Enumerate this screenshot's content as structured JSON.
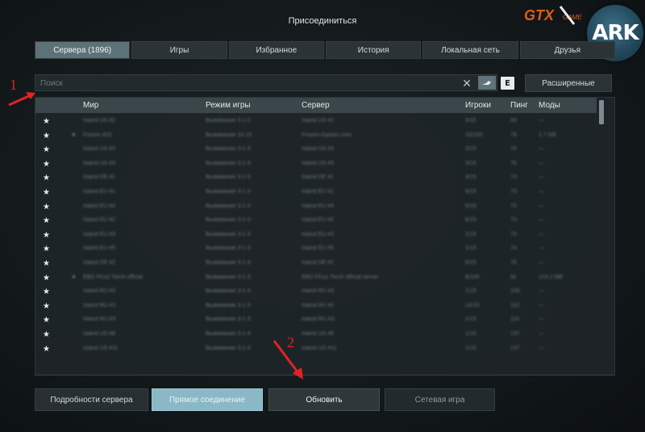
{
  "window": {
    "title": "Присоединиться"
  },
  "logos": {
    "gtx": "GTX",
    "gtx_small": "GAME",
    "ark": "ARK"
  },
  "tabs": [
    {
      "label": "Сервера (1896)",
      "active": true
    },
    {
      "label": "Игры",
      "active": false
    },
    {
      "label": "Избранное",
      "active": false
    },
    {
      "label": "История",
      "active": false
    },
    {
      "label": "Локальная сеть",
      "active": false
    },
    {
      "label": "Друзья",
      "active": false
    }
  ],
  "search": {
    "placeholder": "Поиск",
    "value": "",
    "clear_icon": "close-icon",
    "steam_icon": "steam-icon",
    "epic_icon": "E"
  },
  "advanced_button": "Расширенные",
  "columns": {
    "world": "Мир",
    "game_mode": "Режим игры",
    "server": "Сервер",
    "players": "Игроки",
    "ping": "Пинг",
    "mods": "Моды"
  },
  "rows": [
    {
      "world": "Island US #2",
      "mode": "Выживание 3-1-3",
      "server": "Island US #2",
      "players": "3/15",
      "ping": "69",
      "mods": "—",
      "flag": false
    },
    {
      "world": "Frozen #23",
      "mode": "Выживание 10-10",
      "server": "Frozen-Games.com",
      "players": "10/100",
      "ping": "79",
      "mods": "1.7 GB",
      "flag": true
    },
    {
      "world": "Island US #3",
      "mode": "Выживание 3-1-3",
      "server": "Island US #3",
      "players": "3/15",
      "ping": "70",
      "mods": "—",
      "flag": false
    },
    {
      "world": "Island US #3",
      "mode": "Выживание 3-1-3",
      "server": "Island US #3",
      "players": "3/15",
      "ping": "70",
      "mods": "—",
      "flag": false
    },
    {
      "world": "Island DE #1",
      "mode": "Выживание 3-1-3",
      "server": "Island DE #1",
      "players": "3/15",
      "ping": "73",
      "mods": "—",
      "flag": false
    },
    {
      "world": "Island EU #1",
      "mode": "Выживание 3-1-3",
      "server": "Island EU #1",
      "players": "6/15",
      "ping": "73",
      "mods": "—",
      "flag": false
    },
    {
      "world": "Island EU #4",
      "mode": "Выживание 3-1-3",
      "server": "Island EU #4",
      "players": "6/15",
      "ping": "73",
      "mods": "—",
      "flag": false
    },
    {
      "world": "Island EU #2",
      "mode": "Выживание 3-1-3",
      "server": "Island EU #2",
      "players": "6/15",
      "ping": "73",
      "mods": "—",
      "flag": false
    },
    {
      "world": "Island EU #3",
      "mode": "Выживание 3-1-3",
      "server": "Island EU #3",
      "players": "1/15",
      "ping": "73",
      "mods": "—",
      "flag": false
    },
    {
      "world": "Island EU #5",
      "mode": "Выживание 3-1-3",
      "server": "Island EU #5",
      "players": "1/15",
      "ping": "74",
      "mods": "—",
      "flag": false
    },
    {
      "world": "Island DE #2",
      "mode": "Выживание 3-1-3",
      "server": "Island DE #2",
      "players": "6/15",
      "ping": "75",
      "mods": "—",
      "flag": false
    },
    {
      "world": "EBD PCoz Torch official",
      "mode": "Выживание 3-1-3",
      "server": "EBD PCoz Torch official server",
      "players": "8/100",
      "ping": "92",
      "mods": "124.2 MB",
      "flag": true
    },
    {
      "world": "Island RU #2",
      "mode": "Выживание 3-1-3",
      "server": "Island RU #2",
      "players": "1/15",
      "ping": "106",
      "mods": "—",
      "flag": false
    },
    {
      "world": "Island RU #1",
      "mode": "Выживание 3-1-3",
      "server": "Island RU #1",
      "players": "14/15",
      "ping": "110",
      "mods": "—",
      "flag": false
    },
    {
      "world": "Island RU #3",
      "mode": "Выживание 3-1-3",
      "server": "Island RU #3",
      "players": "1/15",
      "ping": "110",
      "mods": "—",
      "flag": false
    },
    {
      "world": "Island US #8",
      "mode": "Выживание 3-1-3",
      "server": "Island US #8",
      "players": "1/15",
      "ping": "137",
      "mods": "—",
      "flag": false
    },
    {
      "world": "Island US #11",
      "mode": "Выживание 3-1-3",
      "server": "Island US #11",
      "players": "1/15",
      "ping": "137",
      "mods": "—",
      "flag": false
    }
  ],
  "buttons": {
    "details": "Подробности сервера",
    "direct": "Прямое соединение",
    "refresh": "Обновить",
    "lan": "Сетевая игра"
  },
  "annotations": {
    "one": "1",
    "two": "2",
    "color": "#e02424"
  },
  "colors": {
    "active_tab": "#5d7178",
    "direct_button": "#8bb8c6",
    "panel": "#1e2528"
  }
}
